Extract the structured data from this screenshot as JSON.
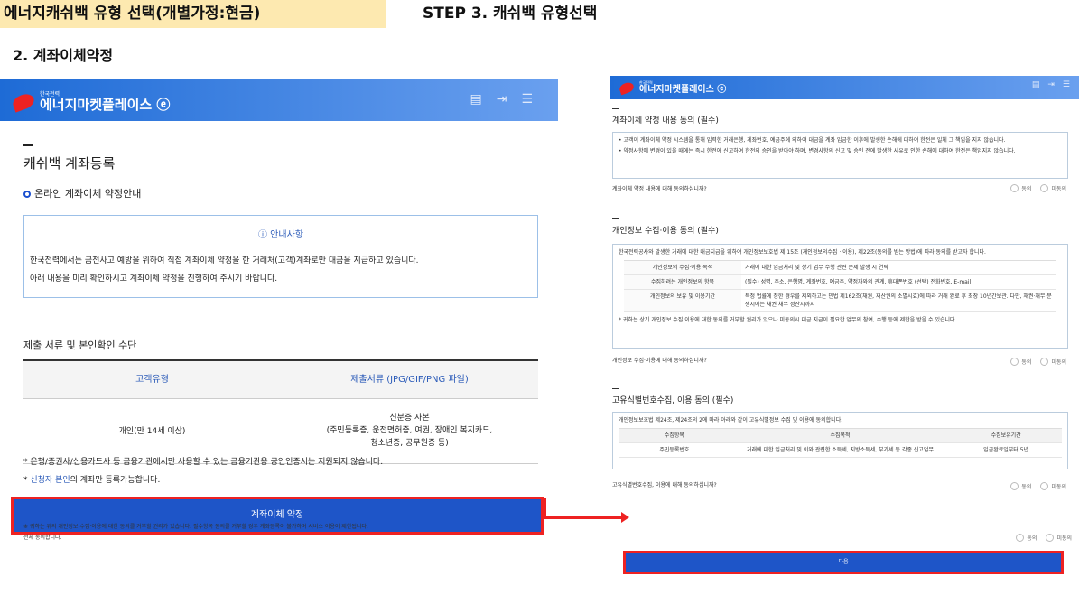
{
  "header": {
    "title_left": "에너지캐쉬백 유형 선택(개별가정:현금)",
    "title_right": "STEP 3. 캐쉬백 유형선택",
    "subtitle": "2. 계좌이체약정"
  },
  "logo": {
    "small": "한국전력",
    "text": "에너지마켓플레이스 ⓔ",
    "color": "#e22222"
  },
  "colors": {
    "bar": "#1e6bd6",
    "button": "#1e55c8",
    "highlight": "#e22222",
    "header_bg": "#fde9b0"
  },
  "left": {
    "page_title": "캐쉬백 계좌등록",
    "section": "온라인 계좌이체 약정안내",
    "notice_heading": "ⓘ 안내사항",
    "notice_line1": "한국전력에서는 금전사고 예방을 위하여 직접 계좌이체 약정을 한 거래처(고객)계좌로만 대금을 지급하고 있습니다.",
    "notice_line2": "아래 내용을 미리 확인하시고 계좌이체 약정을 진행하여 주시기 바랍니다.",
    "docs_heading": "제출 서류 및 본인확인 수단",
    "table_headers": [
      "고객유형",
      "제출서류 (JPG/GIF/PNG 파일)"
    ],
    "row_type": "개인(만 14세 이상)",
    "row_doc1": "신분증 사본",
    "row_doc2": "(주민등록증, 운전면허증, 여권, 장애인 복지카드,",
    "row_doc3": "청소년증, 공무원증 등)",
    "footnote1": "* 은행/증권사/신용카드사 등 금융기관에서만 사용할 수 있는 금융기관용 공인인증서는 지원되지 않습니다.",
    "footnote2_prefix": "* ",
    "footnote2_link": "신청자 본인",
    "footnote2_suffix": "의 계좌만 등록가능합니다.",
    "button": "계좌이체 약정"
  },
  "right": {
    "s1_title": "계좌이체 약정 내용 동의 (필수)",
    "s1_line1": "• 고객이 계좌이체 약정 시스템을 통해 입력한 거래은행, 계좌번호, 예금주에 의하여 대금을 계좌 입금한 이후에 발생한 손해에 대하여 한전은 일체 그 책임을 지지 않습니다.",
    "s1_line2": "• 약정사항에 변경이 있을 때에는 즉시 한전에 신고하여 한전의 승인을 받아야 하며, 변경사항의 신고 및 승인 전에 발생한 사유로 인한 손해에 대하여 한전은 책임지지 않습니다.",
    "s1_q": "계좌이체 약정 내용에 대해 동의하십니까?",
    "agree": "동의",
    "disagree": "미동의",
    "s2_title": "개인정보 수집·이용 동의 (필수)",
    "s2_intro": "한국전력공사와 발생한 거래에 대한 대금지급을 위하여 개인정보보호법 제 15조 (개인정보의수집 · 이용), 제22조(동의를 받는 방법)에 따라 동의를 받고자 합니다.",
    "s2_rows": [
      {
        "k": "개인정보의 수집·이용 목적",
        "v": "거래에 대한 입금처리 및 상기 업무 수행 관련 문제 발생 시 연락"
      },
      {
        "k": "수집하려는 개인정보의 항목",
        "v": "(필수) 성명, 주소, 은행명, 계좌번호, 예금주, 약정자와의 관계, 휴대폰번호 (선택) 전화번호, E-mail"
      },
      {
        "k": "개인정보의 보유 및 이용기간",
        "v": "특정 법률에 정한 경우를 제외하고는 민법 제162조(채권, 재산권의 소멸시효)에 따라 거래 완료 후 최장 10년간보관. 다만, 채권·채무 분쟁시에는 채권 채무 정산시까지"
      }
    ],
    "s2_note": "* 귀하는 상기 개인정보 수집·이용에 대한 동의를 거부할 권리가 있으나 미동의시 대금 지급이 필요한 업무의 참여, 수행 등에 제한을 받을 수 있습니다.",
    "s2_q": "개인정보 수집·이용에 대해 동의하십니까?",
    "s3_title": "고유식별번호수집, 이용 동의 (필수)",
    "s3_intro": "개인정보보호법 제24조, 제24조의 2에 따라 아래와 같이 고유식별정보 수집 및 이용에 동의합니다.",
    "s3_headers": [
      "수집항목",
      "수집목적",
      "수집보유기간"
    ],
    "s3_row": [
      "주민등록번호",
      "거래에 대한 입금처리 및 이와 관련한 소득세, 지방소득세, 부가세 등 각종 신고업무",
      "입금완료일부터 5년"
    ],
    "s3_q": "고유식별번호수집, 이용에 대해 동의하십니까?",
    "final_note": "※ 귀하는 위의 개인정보 수집·이용에 대한 동의를 거부할 권리가 있습니다. 필수항목 동의를 거부할 경우 계좌등록이 불가하며 서비스 이용이 제한됩니다.",
    "all_agree": "전체 동의합니다.",
    "button": "다음"
  }
}
